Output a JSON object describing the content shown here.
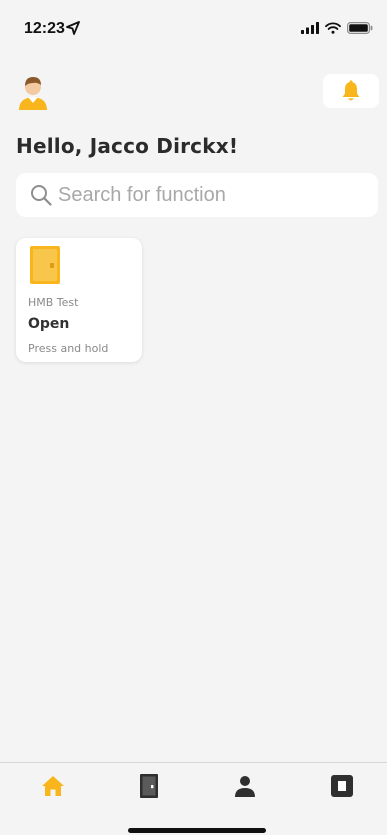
{
  "status_bar": {
    "time": "12:23"
  },
  "header": {
    "greeting": "Hello, Jacco Dirckx!"
  },
  "search": {
    "placeholder": "Search for function",
    "value": ""
  },
  "functions": [
    {
      "subtitle": "HMB Test",
      "title": "Open",
      "hint": "Press and hold"
    }
  ],
  "colors": {
    "accent": "#f9b61c",
    "background": "#f4f4f4",
    "tab_inactive": "#2f2f2f"
  },
  "tabs": [
    {
      "icon": "home-icon",
      "active": true
    },
    {
      "icon": "door-icon",
      "active": false
    },
    {
      "icon": "person-icon",
      "active": false
    },
    {
      "icon": "square-icon",
      "active": false
    }
  ]
}
